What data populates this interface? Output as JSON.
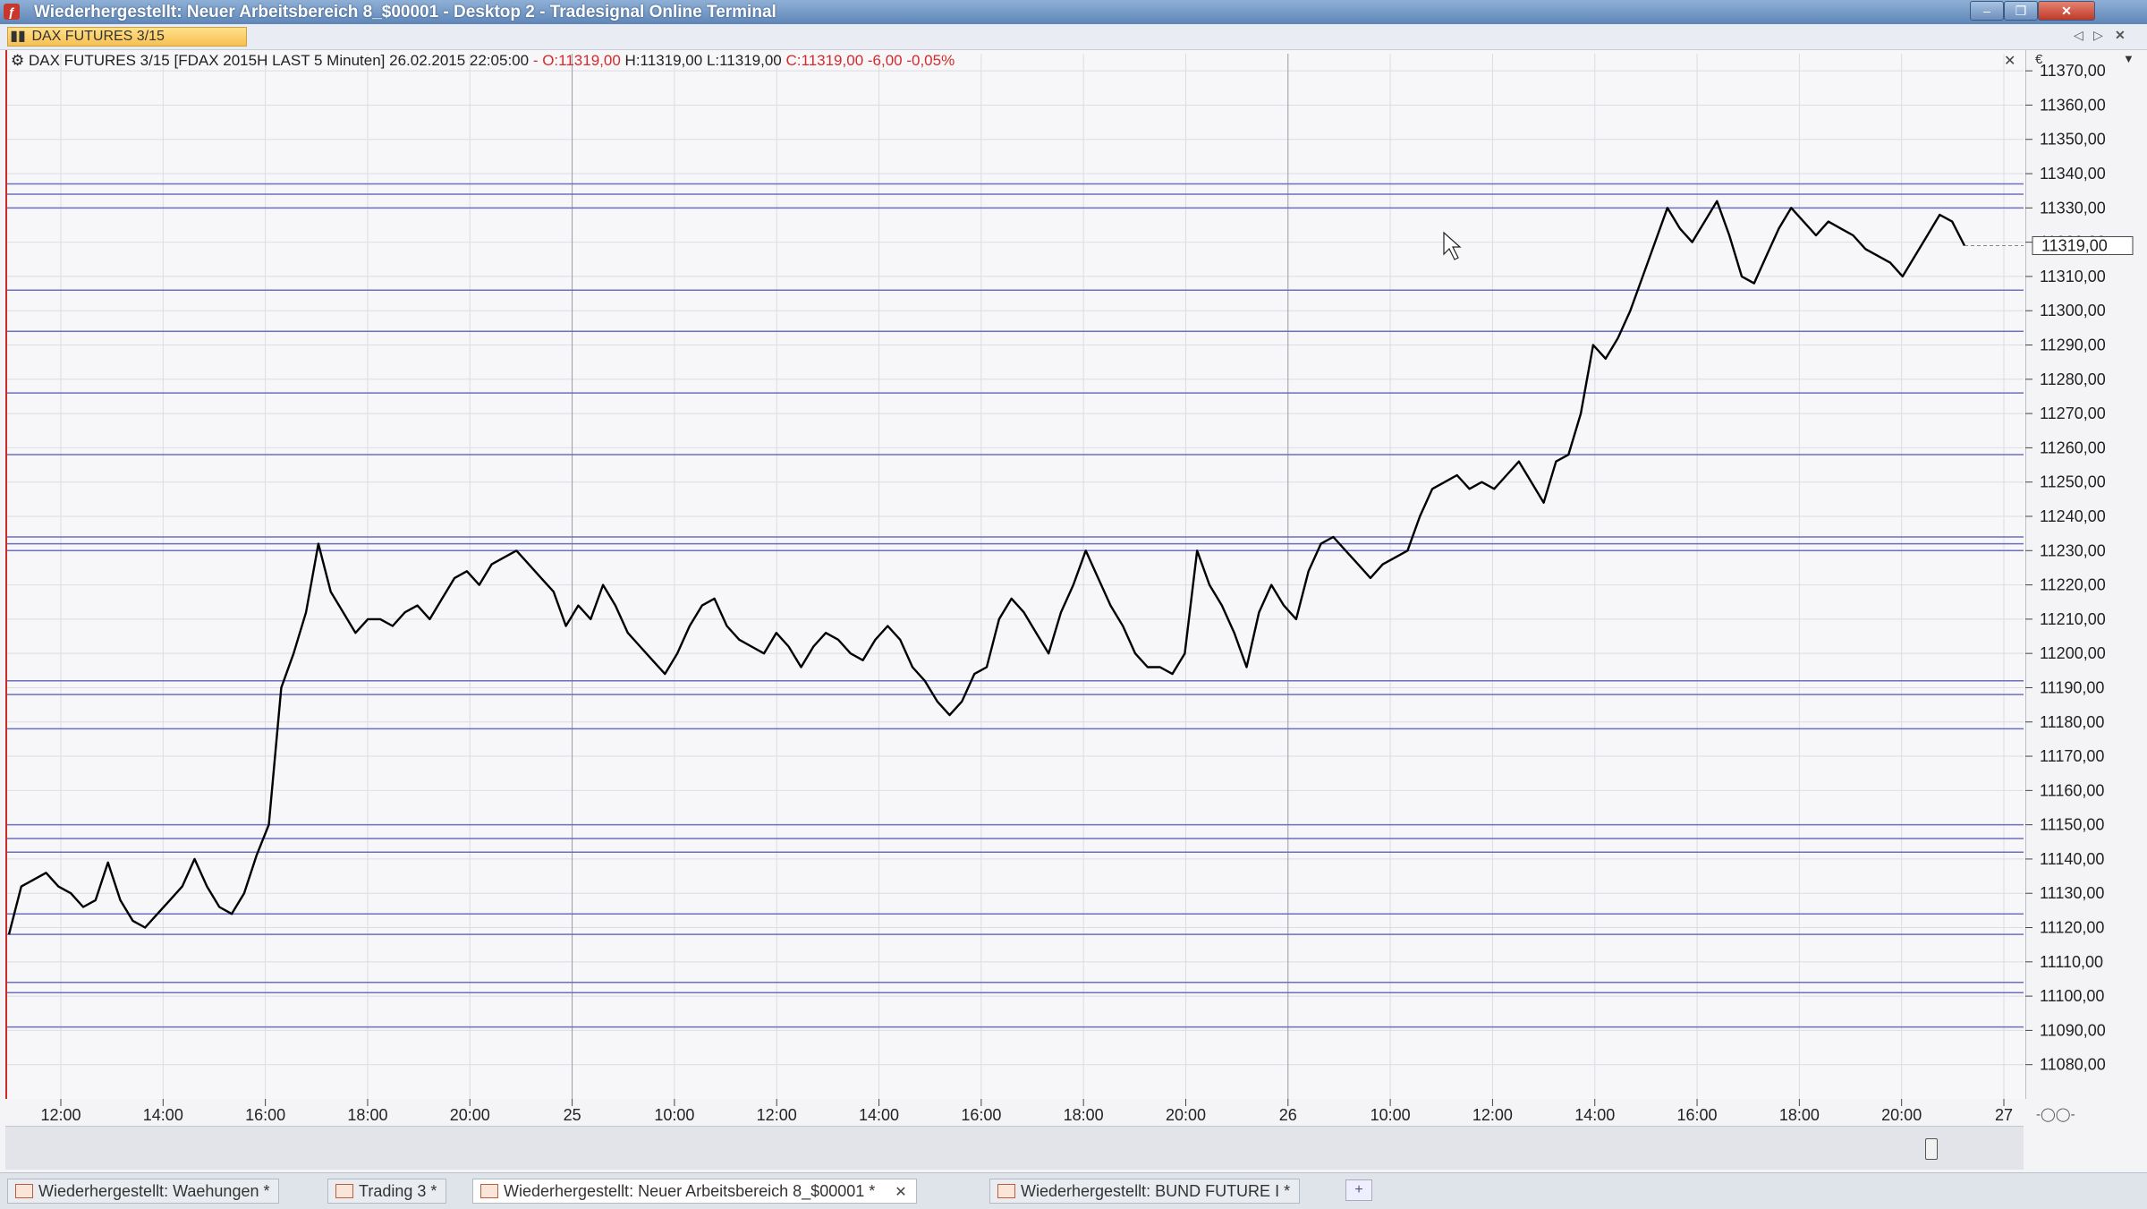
{
  "window": {
    "title": "Wiederhergestellt: Neuer Arbeitsbereich 8_$00001 - Desktop 2 - Tradesignal Online Terminal",
    "app_icon": "tradesignal-icon",
    "controls": {
      "minimize": "‒",
      "maximize": "❐",
      "close": "✕"
    }
  },
  "chart_tab": {
    "label": "DAX FUTURES 3/15"
  },
  "chart_info": {
    "symbol": "DAX FUTURES 3/15 [FDAX 2015H LAST 5 Minuten] 26.02.2015 22:05:00",
    "open": "- O:11319,00",
    "high": "H:11319,00",
    "low": "L:11319,00",
    "close": "C:11319,00 -6,00 -0,05%"
  },
  "price_axis": {
    "currency_label": "€",
    "current_price_label": "11319,00"
  },
  "nav_icons": {
    "prev": "◁",
    "next": "▷",
    "close": "✕",
    "zoom": "-◯◯-"
  },
  "status_tabs": [
    {
      "label": "Wiederhergestellt: Waehungen *"
    },
    {
      "label": "Trading 3 *"
    },
    {
      "label": "Wiederhergestellt: Neuer Arbeitsbereich 8_$00001 *",
      "active": true
    },
    {
      "label": "Wiederhergestellt: BUND FUTURE I *"
    }
  ],
  "colors": {
    "price_line": "#000000",
    "level_line": "#6b6fc2",
    "grid": "#dcdce2",
    "accent": "#cc2b2b"
  },
  "chart_data": {
    "type": "line",
    "title": "DAX FUTURES 3/15 [FDAX 2015H LAST 5 Minuten]",
    "xlabel": "",
    "ylabel": "",
    "ylim": [
      11070,
      11375
    ],
    "yticks": [
      11080,
      11090,
      11100,
      11110,
      11120,
      11130,
      11140,
      11150,
      11160,
      11170,
      11180,
      11190,
      11200,
      11210,
      11220,
      11230,
      11240,
      11250,
      11260,
      11270,
      11280,
      11290,
      11300,
      11310,
      11320,
      11330,
      11340,
      11350,
      11360,
      11370
    ],
    "xtick_labels": [
      "12:00",
      "14:00",
      "16:00",
      "18:00",
      "20:00",
      "25",
      "10:00",
      "12:00",
      "14:00",
      "16:00",
      "18:00",
      "20:00",
      "26",
      "10:00",
      "12:00",
      "14:00",
      "16:00",
      "18:00",
      "20:00",
      "27"
    ],
    "day_separators": [
      "25",
      "26"
    ],
    "grid": true,
    "series": [
      {
        "values": [
          11118,
          11132,
          11134,
          11136,
          11132,
          11130,
          11126,
          11128,
          11139,
          11128,
          11122,
          11120,
          11124,
          11128,
          11132,
          11140,
          11132,
          11126,
          11124,
          11130,
          11141,
          11150,
          11190,
          11200,
          11212,
          11232,
          11218,
          11212,
          11206,
          11210,
          11210,
          11208,
          11212,
          11214,
          11210,
          11216,
          11222,
          11224,
          11220,
          11226,
          11228,
          11230,
          11226,
          11222,
          11218,
          11208,
          11214,
          11210,
          11220,
          11214,
          11206,
          11202,
          11198,
          11194,
          11200,
          11208,
          11214,
          11216,
          11208,
          11204,
          11202,
          11200,
          11206,
          11202,
          11196,
          11202,
          11206,
          11204,
          11200,
          11198,
          11204,
          11208,
          11204,
          11196,
          11192,
          11186,
          11182,
          11186,
          11194,
          11196,
          11210,
          11216,
          11212,
          11206,
          11200,
          11212,
          11220,
          11230,
          11222,
          11214,
          11208,
          11200,
          11196,
          11196,
          11194,
          11200,
          11230,
          11220,
          11214,
          11206,
          11196,
          11212,
          11220,
          11214,
          11210,
          11224,
          11232,
          11234,
          11230,
          11226,
          11222,
          11226,
          11228,
          11230,
          11240,
          11248,
          11250,
          11252,
          11248,
          11250,
          11248,
          11252,
          11256,
          11250,
          11244,
          11256,
          11258,
          11270,
          11290,
          11286,
          11292,
          11300,
          11310,
          11320,
          11330,
          11324,
          11320,
          11326,
          11332,
          11322,
          11310,
          11308,
          11316,
          11324,
          11330,
          11326,
          11322,
          11326,
          11324,
          11322,
          11318,
          11316,
          11314,
          11310,
          11316,
          11322,
          11328,
          11326,
          11319
        ],
        "high": 11336,
        "low": 11116,
        "last": 11319
      }
    ],
    "horizontal_levels": [
      11337,
      11334,
      11330,
      11306,
      11294,
      11276,
      11258,
      11234,
      11232,
      11230,
      11192,
      11188,
      11178,
      11150,
      11146,
      11142,
      11124,
      11118,
      11104,
      11101,
      11091
    ]
  }
}
